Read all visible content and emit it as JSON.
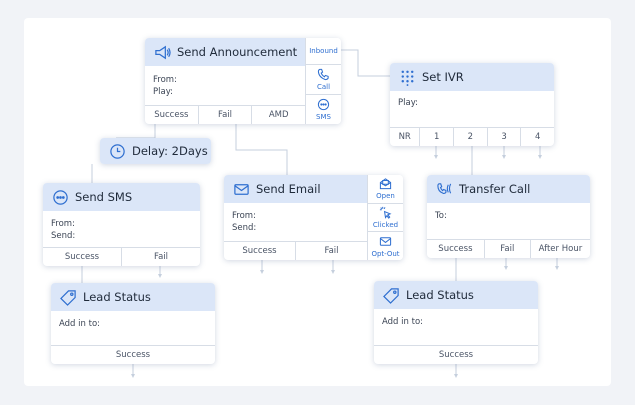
{
  "nodes": {
    "announcement": {
      "title": "Send Announcement",
      "from_label": "From:",
      "play_label": "Play:",
      "outputs": [
        "Success",
        "Fail",
        "AMD"
      ],
      "side": {
        "inbound": "Inbound",
        "call": "Call",
        "sms": "SMS"
      }
    },
    "ivr": {
      "title": "Set IVR",
      "play_label": "Play:",
      "outputs": [
        "NR",
        "1",
        "2",
        "3",
        "4"
      ]
    },
    "delay": {
      "title": "Delay: 2Days"
    },
    "sms": {
      "title": "Send SMS",
      "from_label": "From:",
      "send_label": "Send:",
      "outputs": [
        "Success",
        "Fail"
      ]
    },
    "email": {
      "title": "Send Email",
      "from_label": "From:",
      "send_label": "Send:",
      "outputs": [
        "Success",
        "Fail"
      ],
      "side": {
        "open": "Open",
        "clicked": "Clicked",
        "optout": "Opt-Out"
      }
    },
    "transfer": {
      "title": "Transfer Call",
      "to_label": "To:",
      "outputs": [
        "Success",
        "Fail",
        "After Hour"
      ]
    },
    "lead_left": {
      "title": "Lead Status",
      "add_label": "Add in to:",
      "outputs": [
        "Success"
      ]
    },
    "lead_right": {
      "title": "Lead Status",
      "add_label": "Add in to:",
      "outputs": [
        "Success"
      ]
    }
  },
  "colors": {
    "header": "#dbe6f8",
    "accent": "#2f6fd0",
    "wire": "#c5cfdd"
  }
}
